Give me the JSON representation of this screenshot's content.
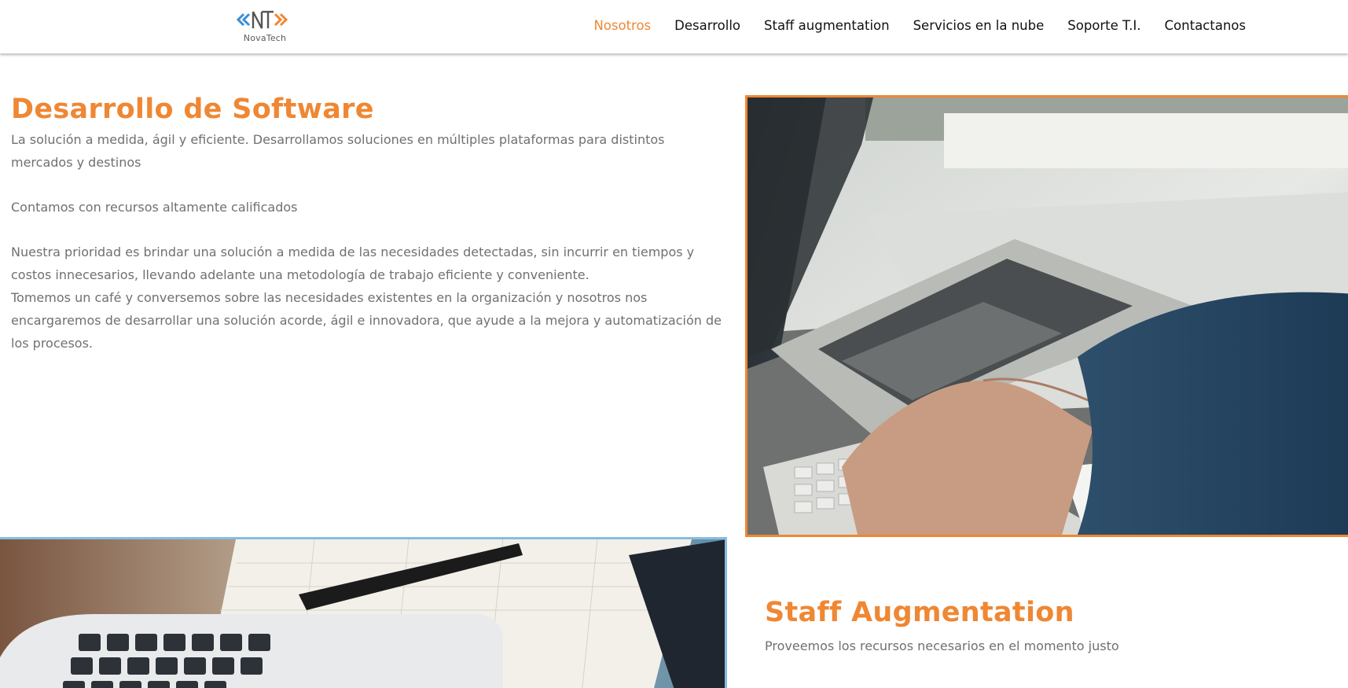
{
  "header": {
    "logo": {
      "mark": "NT",
      "text": "NovaTech"
    },
    "nav": [
      {
        "label": "Nosotros",
        "active": true
      },
      {
        "label": "Desarrollo",
        "active": false
      },
      {
        "label": "Staff augmentation",
        "active": false
      },
      {
        "label": "Servicios en la nube",
        "active": false
      },
      {
        "label": "Soporte T.I.",
        "active": false
      },
      {
        "label": "Contactanos",
        "active": false
      }
    ]
  },
  "section_software": {
    "title": "Desarrollo de Software",
    "intro": "La solución a medida, ágil y eficiente. Desarrollamos soluciones en múltiples plataformas para distintos mercados y destinos",
    "resources": "Contamos con recursos altamente calificados",
    "priority": "Nuestra prioridad es brindar una solución a medida de las necesidades detectadas, sin incurrir en tiempos y costos innecesarios, llevando adelante una metodología de trabajo eficiente y conveniente.",
    "coffee": "Tomemos un café y conversemos sobre las necesidades existentes en la organización y nosotros nos encargaremos de desarrollar una solución acorde, ágil e innovadora, que ayude a la mejora y automatización de los procesos.",
    "image": "laptop-typing-photo"
  },
  "section_staff": {
    "title": "Staff Augmentation",
    "text": "Proveemos los recursos necesarios en el momento justo",
    "image": "desk-laptop-notebook-photo"
  },
  "colors": {
    "accent": "#ef8733",
    "accent_blue": "#3a8fd6",
    "frame_blue": "#87bde0",
    "body_text": "#707070",
    "nav_text": "#111111"
  }
}
